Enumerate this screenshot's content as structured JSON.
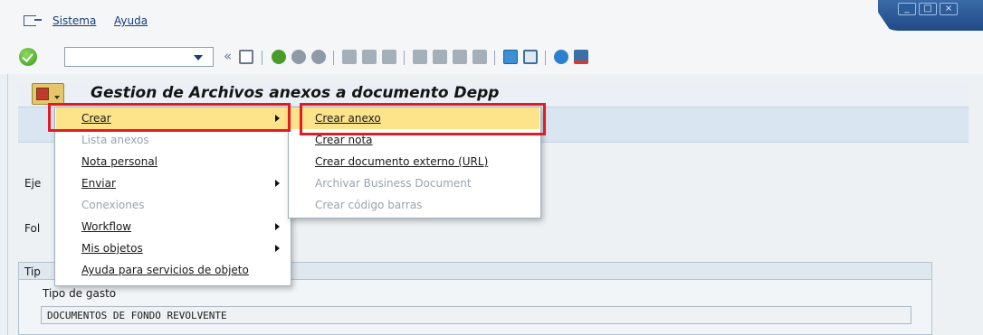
{
  "menubar": {
    "items": [
      "Sistema",
      "Ayuda"
    ]
  },
  "toolbar": {
    "command_value": ""
  },
  "page": {
    "title": "Gestion de Archivos anexos a documento Depp"
  },
  "form": {
    "side_labels": [
      "Eje",
      "Fol",
      "Tip"
    ],
    "field_label": "Tipo de gasto",
    "field_value": "DOCUMENTOS DE FONDO REVOLVENTE"
  },
  "context_menu": {
    "items": [
      {
        "label": "Crear",
        "disabled": false,
        "submenu": true,
        "highlighted": true
      },
      {
        "label": "Lista anexos",
        "disabled": true,
        "submenu": false
      },
      {
        "label": "Nota personal",
        "disabled": false,
        "submenu": false
      },
      {
        "label": "Enviar",
        "disabled": false,
        "submenu": true
      },
      {
        "label": "Conexiones",
        "disabled": true,
        "submenu": false
      },
      {
        "label": "Workflow",
        "disabled": false,
        "submenu": true
      },
      {
        "label": "Mis objetos",
        "disabled": false,
        "submenu": true
      },
      {
        "label": "Ayuda para servicios de objeto",
        "disabled": false,
        "submenu": false
      }
    ]
  },
  "submenu": {
    "items": [
      {
        "label": "Crear anexo",
        "disabled": false,
        "highlighted": true
      },
      {
        "label": "Crear nota",
        "disabled": false
      },
      {
        "label": "Crear documento externo (URL)",
        "disabled": false
      },
      {
        "label": "Archivar Business Document",
        "disabled": true
      },
      {
        "label": "Crear código barras",
        "disabled": true
      }
    ]
  },
  "colors": {
    "highlight": "#fde38a",
    "annotation": "#e31b23",
    "title_bar": "#1f4a86"
  }
}
